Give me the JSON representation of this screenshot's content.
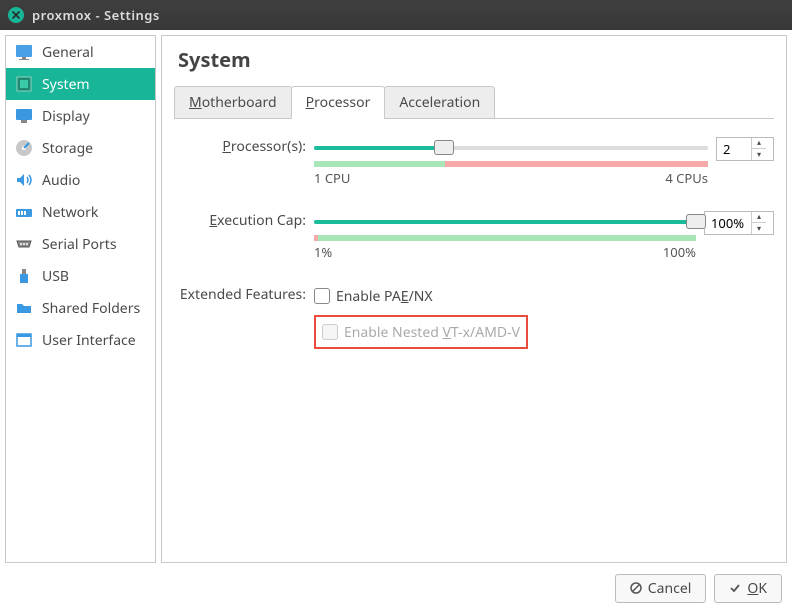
{
  "window": {
    "title": "proxmox - Settings"
  },
  "sidebar": {
    "items": [
      {
        "label": "General"
      },
      {
        "label": "System"
      },
      {
        "label": "Display"
      },
      {
        "label": "Storage"
      },
      {
        "label": "Audio"
      },
      {
        "label": "Network"
      },
      {
        "label": "Serial Ports"
      },
      {
        "label": "USB"
      },
      {
        "label": "Shared Folders"
      },
      {
        "label": "User Interface"
      }
    ]
  },
  "page": {
    "title": "System",
    "tabs": {
      "motherboard": "Motherboard",
      "processor": "Processor",
      "acceleration": "Acceleration"
    },
    "processors_label": "Processor(s):",
    "processors_value": "2",
    "proc_min": "1 CPU",
    "proc_max": "4 CPUs",
    "exec_label": "Execution Cap:",
    "exec_value": "100%",
    "exec_min": "1%",
    "exec_max": "100%",
    "features_label": "Extended Features:",
    "chk_pae": "Enable PAE/NX",
    "chk_nested": "Enable Nested VT-x/AMD-V"
  },
  "footer": {
    "cancel": "Cancel",
    "ok": "OK"
  }
}
